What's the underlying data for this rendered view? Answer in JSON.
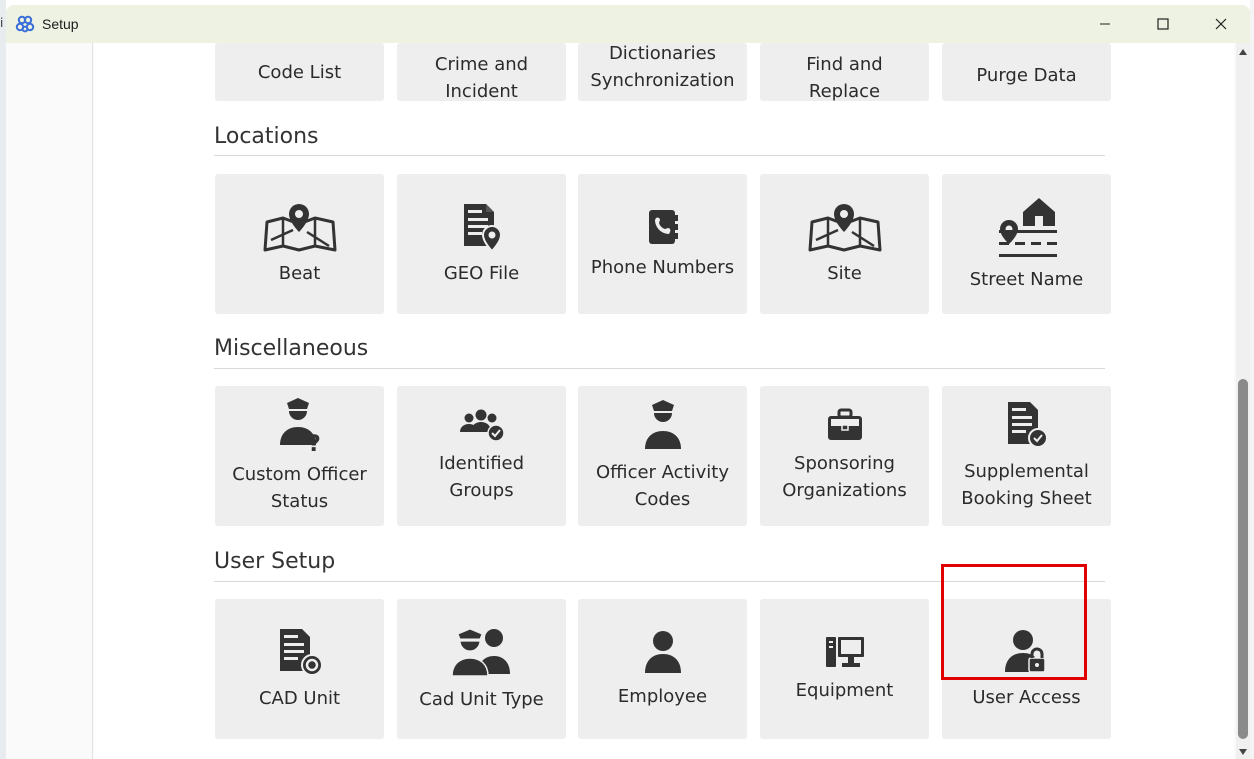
{
  "window": {
    "title": "Setup",
    "side_fragment": "i"
  },
  "colors": {
    "titlebar_bg": "#eef2e3",
    "tile_bg": "#eeeeee",
    "icon_color": "#333333",
    "highlight": "#e00000"
  },
  "top_row": [
    {
      "label": "Code List"
    },
    {
      "label": "Crime and Incident"
    },
    {
      "label": "Dictionaries Synchronization"
    },
    {
      "label": "Find and Replace"
    },
    {
      "label": "Purge Data"
    }
  ],
  "sections": {
    "locations": {
      "title": "Locations",
      "items": [
        {
          "label": "Beat",
          "icon": "map-pin-icon"
        },
        {
          "label": "GEO File",
          "icon": "document-pin-icon"
        },
        {
          "label": "Phone Numbers",
          "icon": "phone-book-icon"
        },
        {
          "label": "Site",
          "icon": "map-pin-icon"
        },
        {
          "label": "Street Name",
          "icon": "street-house-icon"
        }
      ]
    },
    "misc": {
      "title": "Miscellaneous",
      "items": [
        {
          "label": "Custom Officer Status",
          "icon": "officer-question-icon"
        },
        {
          "label": "Identified Groups",
          "icon": "group-check-icon"
        },
        {
          "label": "Officer Activity Codes",
          "icon": "officer-icon"
        },
        {
          "label": "Sponsoring Organizations",
          "icon": "briefcase-icon"
        },
        {
          "label": "Supplemental Booking Sheet",
          "icon": "document-check-icon"
        }
      ]
    },
    "user_setup": {
      "title": "User Setup",
      "items": [
        {
          "label": "CAD Unit",
          "icon": "document-gear-icon"
        },
        {
          "label": "Cad Unit Type",
          "icon": "officer-pair-icon"
        },
        {
          "label": "Employee",
          "icon": "user-icon"
        },
        {
          "label": "Equipment",
          "icon": "computer-icon"
        },
        {
          "label": "User Access",
          "icon": "user-lock-icon"
        }
      ]
    }
  }
}
